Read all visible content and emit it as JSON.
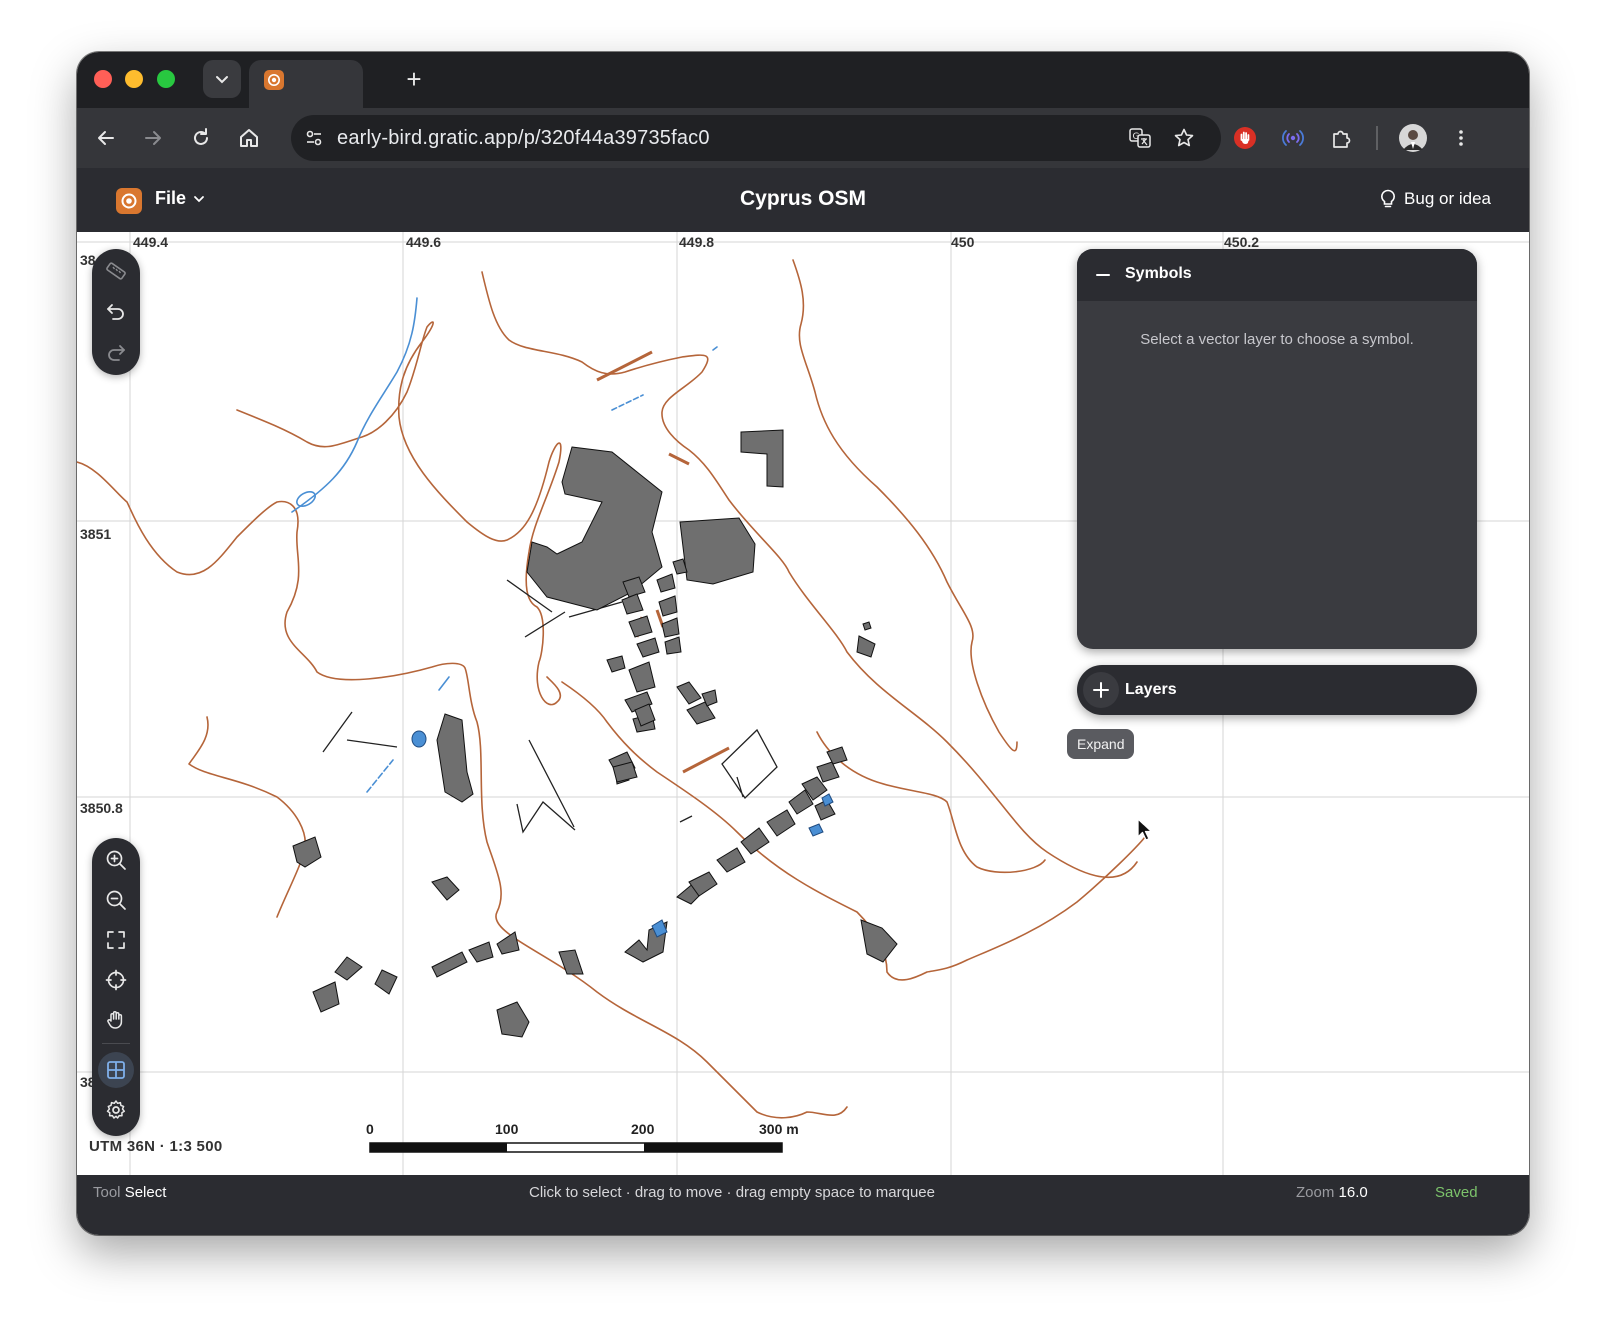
{
  "browser": {
    "url": "early-bird.gratic.app/p/320f44a39735fac0",
    "new_tab_symbol": "+"
  },
  "app": {
    "file_menu_label": "File",
    "title": "Cyprus OSM",
    "feedback_label": "Bug or idea"
  },
  "map": {
    "x_ticks": [
      "449.4",
      "449.6",
      "449.8",
      "450",
      "450.2"
    ],
    "y_ticks": [
      "38",
      "3851",
      "3850.8",
      "38"
    ],
    "crs_label": "UTM 36N · 1:3 500",
    "scalebar": [
      "0",
      "100",
      "200",
      "300 m"
    ]
  },
  "panels": {
    "symbols_title": "Symbols",
    "symbols_hint": "Select a vector layer to choose a symbol.",
    "layers_title": "Layers",
    "expand_tooltip": "Expand"
  },
  "status": {
    "tool_label": "Tool",
    "tool_value": "Select",
    "hint": "Click to select · drag to move · drag empty space to marquee",
    "zoom_label": "Zoom",
    "zoom_value": "16.0",
    "save_state": "Saved"
  },
  "colors": {
    "contour": "#b5653a",
    "water": "#4a8fd4",
    "building_fill": "#6f6f6f",
    "accent": "#d9772f",
    "saved": "#7cc36b"
  },
  "icons": {
    "favicon": "gratic-logo-icon",
    "tools": [
      "ruler-icon",
      "undo-icon",
      "redo-icon"
    ],
    "nav": [
      "zoom-in-icon",
      "zoom-out-icon",
      "fit-extent-icon",
      "locate-icon",
      "pan-hand-icon",
      "grid-icon",
      "settings-icon"
    ]
  }
}
